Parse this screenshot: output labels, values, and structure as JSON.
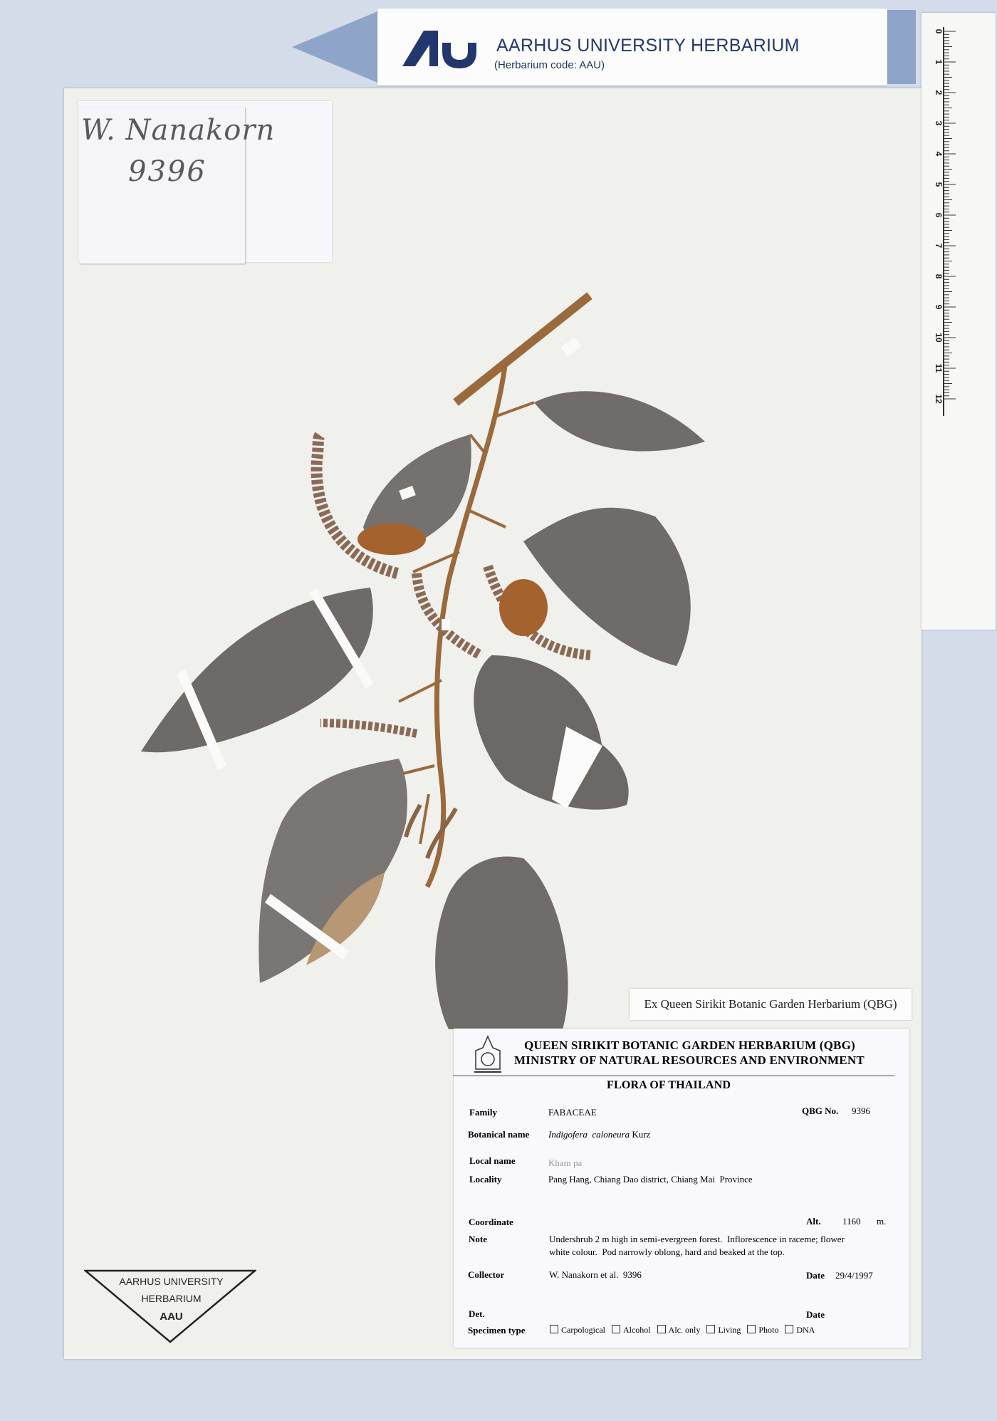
{
  "banner": {
    "title": "AARHUS UNIVERSITY HERBARIUM",
    "code": "(Herbarium code: AAU)"
  },
  "ruler": {
    "ticks": [
      "0",
      "1",
      "2",
      "3",
      "4",
      "5",
      "6",
      "7",
      "8",
      "9",
      "10",
      "11",
      "12"
    ]
  },
  "collector_slip": {
    "name": "W. Nanakorn",
    "number": "9396"
  },
  "ex_label": "Ex Queen Sirikit Botanic Garden Herbarium (QBG)",
  "qbg_label": {
    "header_line1": "QUEEN SIRIKIT BOTANIC GARDEN HERBARIUM (QBG)",
    "header_line2": "MINISTRY OF NATURAL RESOURCES AND ENVIRONMENT",
    "flora": "FLORA OF THAILAND",
    "family_label": "Family",
    "family": "FABACEAE",
    "qbg_no_label": "QBG No.",
    "qbg_no": "9396",
    "botanical_label": "Botanical name",
    "botanical_genus_species": "Indigofera  caloneura",
    "botanical_author": "Kurz",
    "local_label": "Local name",
    "local": "Kham pa",
    "locality_label": "Locality",
    "locality": "Pang Hang, Chiang Dao district, Chiang Mai  Province",
    "coordinate_label": "Coordinate",
    "alt_label": "Alt.",
    "alt_value": "1160",
    "alt_unit": "m.",
    "note_label": "Note",
    "note_line1": "Undershrub 2 m high in semi-evergreen forest.  Inflorescence in raceme; flower",
    "note_line2": "white colour.  Pod narrowly oblong, hard and beaked at the top.",
    "collector_label": "Collector",
    "collector": "W. Nanakorn et al.  9396",
    "date_label": "Date",
    "date": "29/4/1997",
    "det_label": "Det.",
    "date2_label": "Date",
    "specimen_type_label": "Specimen type",
    "specimen_types": [
      "Carpological",
      "Alcohol",
      "Alc. only",
      "Living",
      "Photo",
      "DNA"
    ]
  },
  "aau_stamp": {
    "line1": "AARHUS UNIVERSITY",
    "line2": "HERBARIUM",
    "line3": "AAU"
  },
  "colors": {
    "background": "#d4dcea",
    "sheet": "#f0f0ec",
    "leaf": "#6f6c6a",
    "stem": "#9a6a3c",
    "au_blue": "#23376e"
  }
}
